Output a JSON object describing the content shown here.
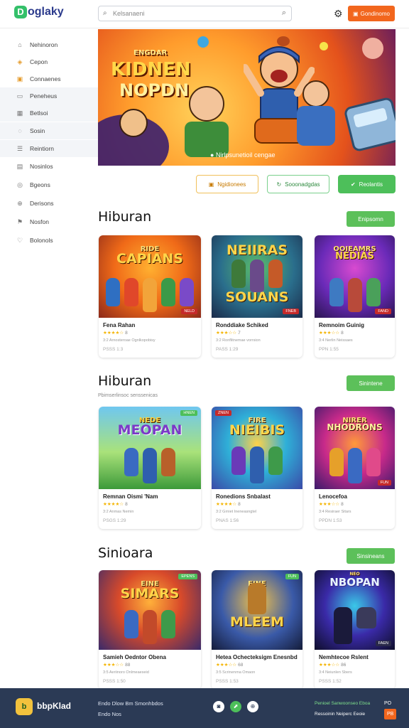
{
  "header": {
    "logo_mark": "D",
    "logo_text": "oglaky",
    "search_placeholder": "Kelsanaeni",
    "cta_label": "Gondinomo"
  },
  "sidebar": {
    "items": [
      {
        "label": "Nehinoron",
        "icon": "home-icon"
      },
      {
        "label": "Cepon",
        "icon": "tag-icon"
      },
      {
        "label": "Connaenes",
        "icon": "gift-icon"
      },
      {
        "label": "Peneheus",
        "icon": "file-icon"
      },
      {
        "label": "Betlsoi",
        "icon": "grid-icon"
      },
      {
        "label": "Sosin",
        "icon": "chat-icon"
      },
      {
        "label": "Reintiorn",
        "icon": "list-icon"
      },
      {
        "label": "Nosinlos",
        "icon": "list-icon"
      },
      {
        "label": "Bgeons",
        "icon": "user-icon"
      },
      {
        "label": "Derisons",
        "icon": "globe-icon"
      },
      {
        "label": "Nosfon",
        "icon": "flag-icon"
      },
      {
        "label": "Bolonols",
        "icon": "heart-icon"
      }
    ]
  },
  "hero": {
    "title_line1": "KIDNEN",
    "title_line2": "NOPDN",
    "title_small": "ENGDAR",
    "caption": "Nirlpsunetioil cengae",
    "actions": [
      {
        "label": "Ngidionees",
        "icon": "box-icon"
      },
      {
        "label": "Sooonadgdas",
        "icon": "refresh-icon"
      },
      {
        "label": "Reolantis",
        "icon": "thumb-icon"
      }
    ]
  },
  "sections": [
    {
      "title": "Hiburan",
      "subtitle": "",
      "button": "Enipsomn",
      "cards": [
        {
          "thumb_top": "RIDE",
          "thumb_main": "CAPIANS",
          "corner": "NELD",
          "name": "Fena Rahan",
          "rating": "★★★★☆",
          "rating_num": "8",
          "desc": "3:2 Arnosteroae Ognlkopobisy",
          "meta": "PSSS 1:3"
        },
        {
          "thumb_top": "NEIIRAS",
          "thumb_main": "SOUANS",
          "corner": "FNEB",
          "name": "Ronddiake Schiked",
          "rating": "★★★☆☆",
          "rating_num": "7",
          "desc": "3:2 Ronflitnemae vorrsion",
          "meta": "PASS 1:29"
        },
        {
          "thumb_top": "OOIEAMRS",
          "thumb_main": "NEDIAS",
          "corner": "FAND",
          "name": "Remnoim Guinig",
          "rating": "★★★☆☆",
          "rating_num": "8",
          "desc": "3:4 Nerlin Neissaes",
          "meta": "PPN 1:55"
        }
      ]
    },
    {
      "title": "Hiburan",
      "subtitle": "Pbimserlinsoc senssenicas",
      "button": "Sinintene",
      "cards": [
        {
          "thumb_top": "NEDE",
          "thumb_main": "MEOPAN",
          "corner": "HNEN",
          "name": "Remnan Oismi 'Nam",
          "rating": "★★★★☆",
          "rating_num": "8",
          "desc": "3:2 Anmas Nemin",
          "meta": "PSGS 1:29"
        },
        {
          "thumb_top": "FIRE",
          "thumb_main": "NIEIBIS",
          "corner": "ZNEN",
          "name": "Ronedions Snbalast",
          "rating": "★★★★☆",
          "rating_num": "8",
          "desc": "3:2 Grniet Ineneasngtel",
          "meta": "PNAS 1:56"
        },
        {
          "thumb_top": "NIRER",
          "thumb_main": "NHODRONS",
          "corner": "FUN",
          "name": "Lenocefoa",
          "rating": "★★★☆☆",
          "rating_num": "8",
          "desc": "3:4 Resiraer Sitars",
          "meta": "PPDN 1:53"
        }
      ]
    },
    {
      "title": "Sinioara",
      "subtitle": "",
      "button": "Sinsineans",
      "cards": [
        {
          "thumb_top": "EINE",
          "thumb_main": "SIMARS",
          "corner": "EPENS",
          "name": "Samieh Oedntor Obena",
          "rating": "★★★☆☆",
          "rating_num": "88",
          "desc": "3:5 Aeriinoro Onlmeaeseid",
          "meta": "PSSS 1:50"
        },
        {
          "thumb_top": "EINE",
          "thumb_main": "MLEEM",
          "corner": "FUN",
          "name": "Hetea Ochecteksigm Enesnbd",
          "rating": "★★★☆☆",
          "rating_num": "68",
          "desc": "3:5 Scrinenrna Omaon",
          "meta": "PSSS 1:53"
        },
        {
          "thumb_top": "NEO",
          "thumb_main": "NBOPAN",
          "corner": "FAEN",
          "name": "Nemhtecoe Rslent",
          "rating": "★★★☆☆",
          "rating_num": "86",
          "desc": "3:4 Neiunlen Sbers",
          "meta": "PSSS 1:52"
        }
      ]
    }
  ],
  "footer": {
    "logo_mark": "b",
    "name": "bbpKlad",
    "links_row1": "Endo  Dlow  Bm  Smonhbdos",
    "links_row2": "Endo  Nos",
    "right_row1": "Penioel Sanwoonseo Eboa",
    "right_row2": "Ressoinin Neiperc Eeoie",
    "right_tag1": "PO",
    "right_tag2": "PB"
  }
}
